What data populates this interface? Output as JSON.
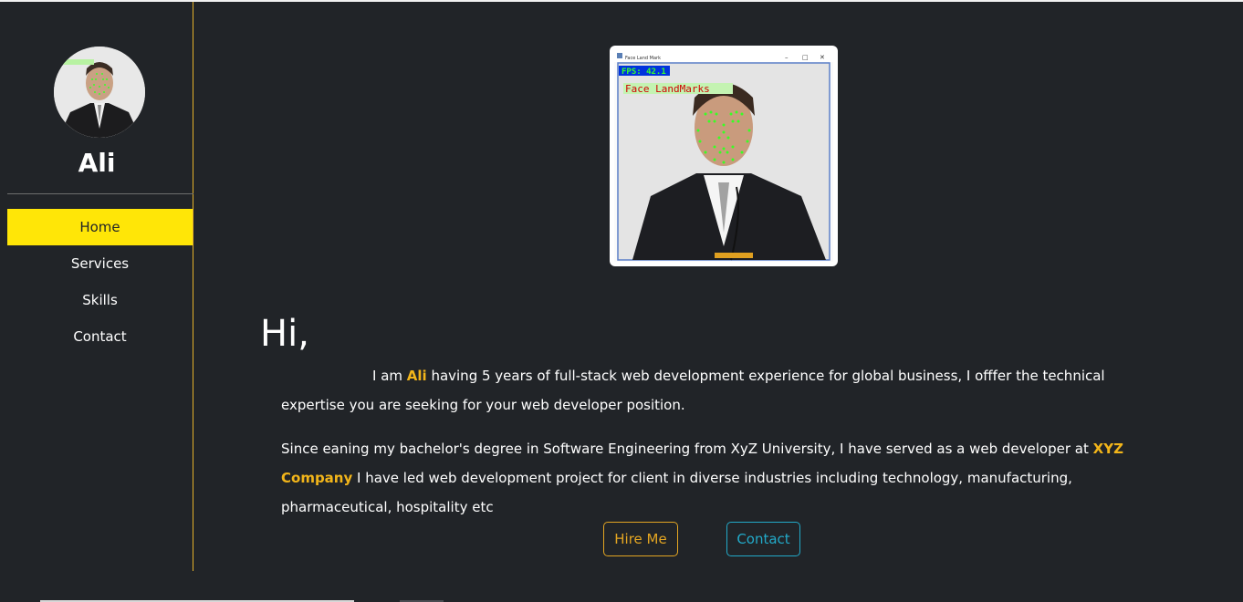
{
  "sidebar": {
    "profile_name": "Ali",
    "nav_items": [
      {
        "label": "Home",
        "active": true
      },
      {
        "label": "Services",
        "active": false
      },
      {
        "label": "Skills",
        "active": false
      },
      {
        "label": "Contact",
        "active": false
      }
    ]
  },
  "photo_window": {
    "window_title": "Face Land Mark",
    "fps_text": "FPS: 42.1",
    "overlay_text": "Face LandMarks"
  },
  "hero": {
    "greeting": "Hi,",
    "intro_prefix": "I am ",
    "intro_name": "Ali",
    "intro_rest": " having 5 years of full-stack web development experience for global business, I offfer the technical expertise you are seeking for your web developer position.",
    "education_prefix": "Since eaning my bachelor's degree in Software Engineering from XyZ University, I have served as a web developer at ",
    "company": "XYZ Company",
    "education_rest": " I have led web development project for client in diverse industries including technology, manufacturing, pharmaceutical, hospitality etc"
  },
  "buttons": {
    "hire_label": "Hire Me",
    "contact_label": "Contact"
  },
  "colors": {
    "background": "#212428",
    "accent_yellow": "#ffe607",
    "highlight_gold": "#f2b51a",
    "hire_border": "#e3a522",
    "contact_border": "#22aac9"
  }
}
